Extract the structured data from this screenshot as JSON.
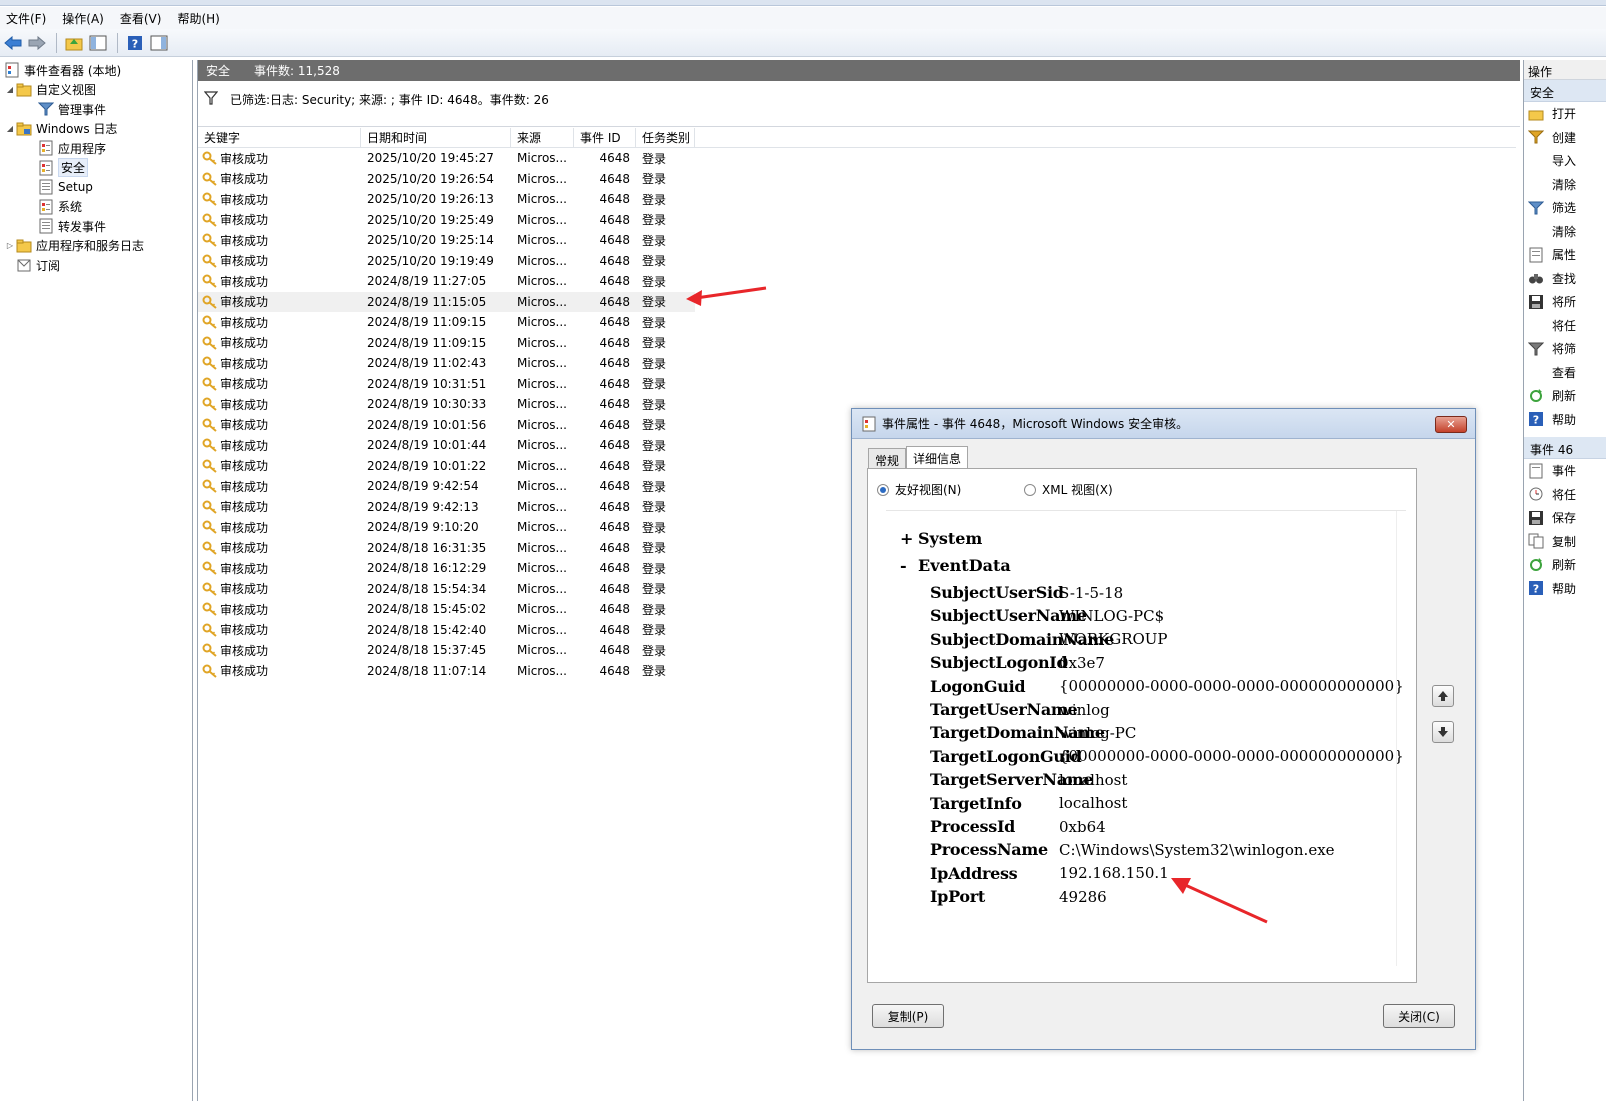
{
  "menu": [
    "文件(F)",
    "操作(A)",
    "查看(V)",
    "帮助(H)"
  ],
  "tree": [
    {
      "label": "事件查看器 (本地)",
      "expander": "",
      "level": 0
    },
    {
      "label": "自定义视图",
      "expander": "◢",
      "level": 1
    },
    {
      "label": "管理事件",
      "expander": "",
      "level": 2
    },
    {
      "label": "Windows 日志",
      "expander": "◢",
      "level": 1
    },
    {
      "label": "应用程序",
      "expander": "",
      "level": 2
    },
    {
      "label": "安全",
      "expander": "",
      "level": 2
    },
    {
      "label": "Setup",
      "expander": "",
      "level": 2
    },
    {
      "label": "系统",
      "expander": "",
      "level": 2
    },
    {
      "label": "转发事件",
      "expander": "",
      "level": 2
    },
    {
      "label": "应用程序和服务日志",
      "expander": "▷",
      "level": 1
    },
    {
      "label": "订阅",
      "expander": "",
      "level": 1
    }
  ],
  "center": {
    "log_name": "安全",
    "event_count": "事件数: 11,528",
    "filter_text": "已筛选:日志: Security; 来源: ; 事件 ID: 4648。事件数: 26",
    "columns": [
      "关键字",
      "日期和时间",
      "来源",
      "事件 ID",
      "任务类别"
    ],
    "rows": [
      [
        "审核成功",
        "2025/10/20 19:45:27",
        "Micros...",
        "4648",
        "登录"
      ],
      [
        "审核成功",
        "2025/10/20 19:26:54",
        "Micros...",
        "4648",
        "登录"
      ],
      [
        "审核成功",
        "2025/10/20 19:26:13",
        "Micros...",
        "4648",
        "登录"
      ],
      [
        "审核成功",
        "2025/10/20 19:25:49",
        "Micros...",
        "4648",
        "登录"
      ],
      [
        "审核成功",
        "2025/10/20 19:25:14",
        "Micros...",
        "4648",
        "登录"
      ],
      [
        "审核成功",
        "2025/10/20 19:19:49",
        "Micros...",
        "4648",
        "登录"
      ],
      [
        "审核成功",
        "2024/8/19 11:27:05",
        "Micros...",
        "4648",
        "登录"
      ],
      [
        "审核成功",
        "2024/8/19 11:15:05",
        "Micros...",
        "4648",
        "登录"
      ],
      [
        "审核成功",
        "2024/8/19 11:09:15",
        "Micros...",
        "4648",
        "登录"
      ],
      [
        "审核成功",
        "2024/8/19 11:09:15",
        "Micros...",
        "4648",
        "登录"
      ],
      [
        "审核成功",
        "2024/8/19 11:02:43",
        "Micros...",
        "4648",
        "登录"
      ],
      [
        "审核成功",
        "2024/8/19 10:31:51",
        "Micros...",
        "4648",
        "登录"
      ],
      [
        "审核成功",
        "2024/8/19 10:30:33",
        "Micros...",
        "4648",
        "登录"
      ],
      [
        "审核成功",
        "2024/8/19 10:01:56",
        "Micros...",
        "4648",
        "登录"
      ],
      [
        "审核成功",
        "2024/8/19 10:01:44",
        "Micros...",
        "4648",
        "登录"
      ],
      [
        "审核成功",
        "2024/8/19 10:01:22",
        "Micros...",
        "4648",
        "登录"
      ],
      [
        "审核成功",
        "2024/8/19 9:42:54",
        "Micros...",
        "4648",
        "登录"
      ],
      [
        "审核成功",
        "2024/8/19 9:42:13",
        "Micros...",
        "4648",
        "登录"
      ],
      [
        "审核成功",
        "2024/8/19 9:10:20",
        "Micros...",
        "4648",
        "登录"
      ],
      [
        "审核成功",
        "2024/8/18 16:31:35",
        "Micros...",
        "4648",
        "登录"
      ],
      [
        "审核成功",
        "2024/8/18 16:12:29",
        "Micros...",
        "4648",
        "登录"
      ],
      [
        "审核成功",
        "2024/8/18 15:54:34",
        "Micros...",
        "4648",
        "登录"
      ],
      [
        "审核成功",
        "2024/8/18 15:45:02",
        "Micros...",
        "4648",
        "登录"
      ],
      [
        "审核成功",
        "2024/8/18 15:42:40",
        "Micros...",
        "4648",
        "登录"
      ],
      [
        "审核成功",
        "2024/8/18 15:37:45",
        "Micros...",
        "4648",
        "登录"
      ],
      [
        "审核成功",
        "2024/8/18 11:07:14",
        "Micros...",
        "4648",
        "登录"
      ]
    ]
  },
  "actions": {
    "title": "操作",
    "section1": "安全",
    "items1": [
      {
        "label": "打开",
        "icon": "folder-open-icon"
      },
      {
        "label": "创建",
        "icon": "filter-create-icon"
      },
      {
        "label": "导入",
        "icon": ""
      },
      {
        "label": "清除",
        "icon": ""
      },
      {
        "label": "筛选",
        "icon": "filter-icon"
      },
      {
        "label": "清除",
        "icon": ""
      },
      {
        "label": "属性",
        "icon": "properties-icon"
      },
      {
        "label": "查找",
        "icon": "binoculars-icon"
      },
      {
        "label": "将所",
        "icon": "save-icon"
      },
      {
        "label": "将任",
        "icon": ""
      },
      {
        "label": "将筛",
        "icon": "filter-save-icon"
      },
      {
        "label": "查看",
        "icon": ""
      },
      {
        "label": "刷新",
        "icon": "refresh-icon"
      },
      {
        "label": "帮助",
        "icon": "help-icon"
      }
    ],
    "section2": "事件 46",
    "items2": [
      {
        "label": "事件",
        "icon": "event-properties-icon"
      },
      {
        "label": "将任",
        "icon": "task-icon"
      },
      {
        "label": "保存",
        "icon": "save-icon"
      },
      {
        "label": "复制",
        "icon": "copy-icon"
      },
      {
        "label": "刷新",
        "icon": "refresh-icon"
      },
      {
        "label": "帮助",
        "icon": "help-icon"
      }
    ]
  },
  "dialog": {
    "title": "事件属性 - 事件 4648，Microsoft Windows 安全审核。",
    "close_glyph": "✕",
    "tabs": [
      "常规",
      "详细信息"
    ],
    "radio_friendly": "友好视图(N)",
    "radio_xml": "XML 视图(X)",
    "system_label": "System",
    "system_sign": "+",
    "eventdata_label": "EventData",
    "eventdata_sign": "-",
    "fields": [
      {
        "key": "SubjectUserSid",
        "value": "S-1-5-18"
      },
      {
        "key": "SubjectUserName",
        "value": "WINLOG-PC$"
      },
      {
        "key": "SubjectDomainName",
        "value": "WORKGROUP"
      },
      {
        "key": "SubjectLogonId",
        "value": "0x3e7"
      },
      {
        "key": "LogonGuid",
        "value": "{00000000-0000-0000-0000-000000000000}"
      },
      {
        "key": "TargetUserName",
        "value": "winlog"
      },
      {
        "key": "TargetDomainName",
        "value": "winlog-PC"
      },
      {
        "key": "TargetLogonGuid",
        "value": "{00000000-0000-0000-0000-000000000000}"
      },
      {
        "key": "TargetServerName",
        "value": "localhost"
      },
      {
        "key": "TargetInfo",
        "value": "localhost"
      },
      {
        "key": "ProcessId",
        "value": "0xb64"
      },
      {
        "key": "ProcessName",
        "value": "C:\\Windows\\System32\\winlogon.exe"
      },
      {
        "key": "IpAddress",
        "value": "192.168.150.1"
      },
      {
        "key": "IpPort",
        "value": "49286"
      }
    ],
    "copy_button": "复制(P)",
    "close_button": "关闭(C)"
  },
  "colors": {
    "center_header_bg": "#6d6d6d",
    "annotation_arrow": "#e8262a",
    "key_icon": "#e0a526"
  }
}
